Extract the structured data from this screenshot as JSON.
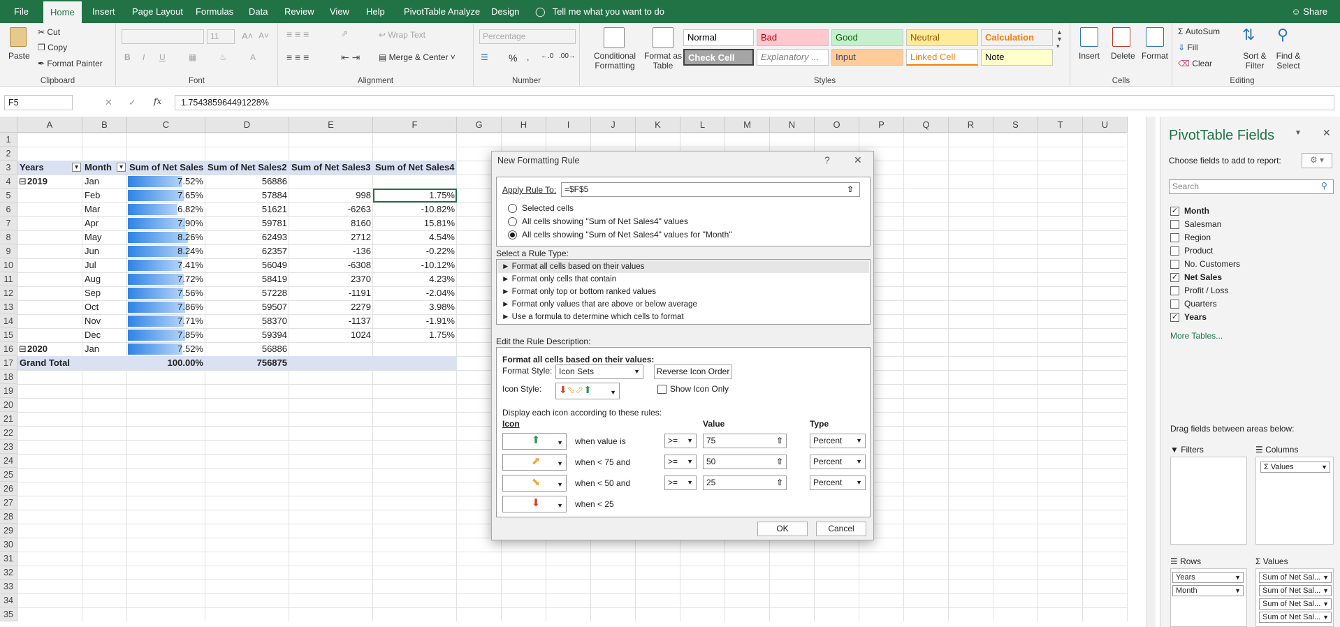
{
  "ribbon_tabs": [
    "File",
    "Home",
    "Insert",
    "Page Layout",
    "Formulas",
    "Data",
    "Review",
    "View",
    "Help",
    "PivotTable Analyze",
    "Design"
  ],
  "tell_me": "Tell me what you want to do",
  "share": "Share",
  "clipboard": {
    "paste": "Paste",
    "cut": "Cut",
    "copy": "Copy",
    "format_painter": "Format Painter",
    "label": "Clipboard"
  },
  "font": {
    "size": "11",
    "label": "Font",
    "b": "B",
    "i": "I",
    "u": "U"
  },
  "alignment": {
    "wrap": "Wrap Text",
    "merge": "Merge & Center",
    "label": "Alignment"
  },
  "number": {
    "format": "Percentage",
    "label": "Number",
    "pct": "%"
  },
  "styles": {
    "cond": "Conditional Formatting",
    "table": "Format as Table",
    "label": "Styles",
    "cells": [
      {
        "name": "Normal",
        "bg": "#ffffff",
        "fg": "#000000"
      },
      {
        "name": "Bad",
        "bg": "#ffc7ce",
        "fg": "#9c0006"
      },
      {
        "name": "Good",
        "bg": "#c6efce",
        "fg": "#006100"
      },
      {
        "name": "Neutral",
        "bg": "#ffeb9c",
        "fg": "#9c5700"
      },
      {
        "name": "Calculation",
        "bg": "#f2f2f2",
        "fg": "#fa7d00"
      },
      {
        "name": "Check Cell",
        "bg": "#a5a5a5",
        "fg": "#ffffff"
      },
      {
        "name": "Explanatory ...",
        "bg": "#ffffff",
        "fg": "#7f7f7f"
      },
      {
        "name": "Input",
        "bg": "#ffcc99",
        "fg": "#3f3f76"
      },
      {
        "name": "Linked Cell",
        "bg": "#ffffff",
        "fg": "#fa7d00"
      },
      {
        "name": "Note",
        "bg": "#ffffcc",
        "fg": "#000000"
      }
    ]
  },
  "cells_grp": {
    "insert": "Insert",
    "delete": "Delete",
    "format": "Format",
    "label": "Cells"
  },
  "editing": {
    "autosum": "AutoSum",
    "fill": "Fill",
    "clear": "Clear",
    "sort": "Sort & Filter",
    "find": "Find & Select",
    "label": "Editing"
  },
  "formula_bar": {
    "name_box": "F5",
    "fx": "fx",
    "value": "1.754385964491228%"
  },
  "columns": [
    "A",
    "B",
    "C",
    "D",
    "E",
    "F",
    "G",
    "H",
    "I",
    "J",
    "K",
    "L",
    "M",
    "N",
    "O",
    "P",
    "Q",
    "R",
    "S",
    "T",
    "U"
  ],
  "table": {
    "headers": [
      "Years",
      "Month",
      "Sum of Net Sales",
      "Sum of Net Sales2",
      "Sum of Net Sales3",
      "Sum of Net Sales4"
    ],
    "rows": [
      {
        "year": "2019",
        "month": "Jan",
        "c": "7.52%",
        "d": "56886",
        "e": "",
        "f": "",
        "bar": 0.752
      },
      {
        "year": "",
        "month": "Feb",
        "c": "7.65%",
        "d": "57884",
        "e": "998",
        "f": "1.75%",
        "bar": 0.765
      },
      {
        "year": "",
        "month": "Mar",
        "c": "6.82%",
        "d": "51621",
        "e": "-6263",
        "f": "-10.82%",
        "bar": 0.682
      },
      {
        "year": "",
        "month": "Apr",
        "c": "7.90%",
        "d": "59781",
        "e": "8160",
        "f": "15.81%",
        "bar": 0.79
      },
      {
        "year": "",
        "month": "May",
        "c": "8.26%",
        "d": "62493",
        "e": "2712",
        "f": "4.54%",
        "bar": 0.826
      },
      {
        "year": "",
        "month": "Jun",
        "c": "8.24%",
        "d": "62357",
        "e": "-136",
        "f": "-0.22%",
        "bar": 0.824
      },
      {
        "year": "",
        "month": "Jul",
        "c": "7.41%",
        "d": "56049",
        "e": "-6308",
        "f": "-10.12%",
        "bar": 0.741
      },
      {
        "year": "",
        "month": "Aug",
        "c": "7.72%",
        "d": "58419",
        "e": "2370",
        "f": "4.23%",
        "bar": 0.772
      },
      {
        "year": "",
        "month": "Sep",
        "c": "7.56%",
        "d": "57228",
        "e": "-1191",
        "f": "-2.04%",
        "bar": 0.756
      },
      {
        "year": "",
        "month": "Oct",
        "c": "7.86%",
        "d": "59507",
        "e": "2279",
        "f": "3.98%",
        "bar": 0.786
      },
      {
        "year": "",
        "month": "Nov",
        "c": "7.71%",
        "d": "58370",
        "e": "-1137",
        "f": "-1.91%",
        "bar": 0.771
      },
      {
        "year": "",
        "month": "Dec",
        "c": "7.85%",
        "d": "59394",
        "e": "1024",
        "f": "1.75%",
        "bar": 0.785
      },
      {
        "year": "2020",
        "month": "Jan",
        "c": "7.52%",
        "d": "56886",
        "e": "",
        "f": "",
        "bar": 0.752
      }
    ],
    "grand_total": {
      "label": "Grand Total",
      "c": "100.00%",
      "d": "756875"
    }
  },
  "dialog": {
    "title": "New Formatting Rule",
    "help": "?",
    "apply_label": "Apply Rule To:",
    "apply_value": "=$F$5",
    "radio1": "Selected cells",
    "radio2": "All cells showing \"Sum of Net Sales4\" values",
    "radio3": "All cells showing \"Sum of Net Sales4\" values for \"Month\"",
    "rule_type_label": "Select a Rule Type:",
    "rule_types": [
      "Format all cells based on their values",
      "Format only cells that contain",
      "Format only top or bottom ranked values",
      "Format only values that are above or below average",
      "Use a formula to determine which cells to format"
    ],
    "edit_label": "Edit the Rule Description:",
    "format_all": "Format all cells based on their values:",
    "format_style_label": "Format Style:",
    "format_style": "Icon Sets",
    "reverse": "Reverse Icon Order",
    "icon_style_label": "Icon Style:",
    "show_icon_only": "Show Icon Only",
    "display_each": "Display each icon according to these rules:",
    "col_icon": "Icon",
    "col_value": "Value",
    "col_type": "Type",
    "rules": [
      {
        "when": "when value is",
        "op": ">=",
        "value": "75",
        "type": "Percent",
        "color": "#2e9a52",
        "dir": "up"
      },
      {
        "when": "when < 75 and",
        "op": ">=",
        "value": "50",
        "type": "Percent",
        "color": "#f2a93b",
        "dir": "ne"
      },
      {
        "when": "when < 50 and",
        "op": ">=",
        "value": "25",
        "type": "Percent",
        "color": "#f2a93b",
        "dir": "se"
      },
      {
        "when": "when < 25",
        "op": "",
        "value": "",
        "type": "",
        "color": "#d9432b",
        "dir": "down"
      }
    ],
    "ok": "OK",
    "cancel": "Cancel"
  },
  "pivot": {
    "title": "PivotTable Fields",
    "choose": "Choose fields to add to report:",
    "search_placeholder": "Search",
    "fields": [
      {
        "name": "Month",
        "checked": true
      },
      {
        "name": "Salesman",
        "checked": false
      },
      {
        "name": "Region",
        "checked": false
      },
      {
        "name": "Product",
        "checked": false
      },
      {
        "name": "No. Customers",
        "checked": false
      },
      {
        "name": "Net Sales",
        "checked": true
      },
      {
        "name": "Profit / Loss",
        "checked": false
      },
      {
        "name": "Quarters",
        "checked": false
      },
      {
        "name": "Years",
        "checked": true
      }
    ],
    "more_tables": "More Tables...",
    "drag": "Drag fields between areas below:",
    "filters": "Filters",
    "columns": "Columns",
    "columns_item": "Values",
    "rows": "Rows",
    "rows_items": [
      "Years",
      "Month"
    ],
    "values": "Values",
    "values_items": [
      "Sum of Net Sal...",
      "Sum of Net Sal...",
      "Sum of Net Sal...",
      "Sum of Net Sal..."
    ]
  }
}
